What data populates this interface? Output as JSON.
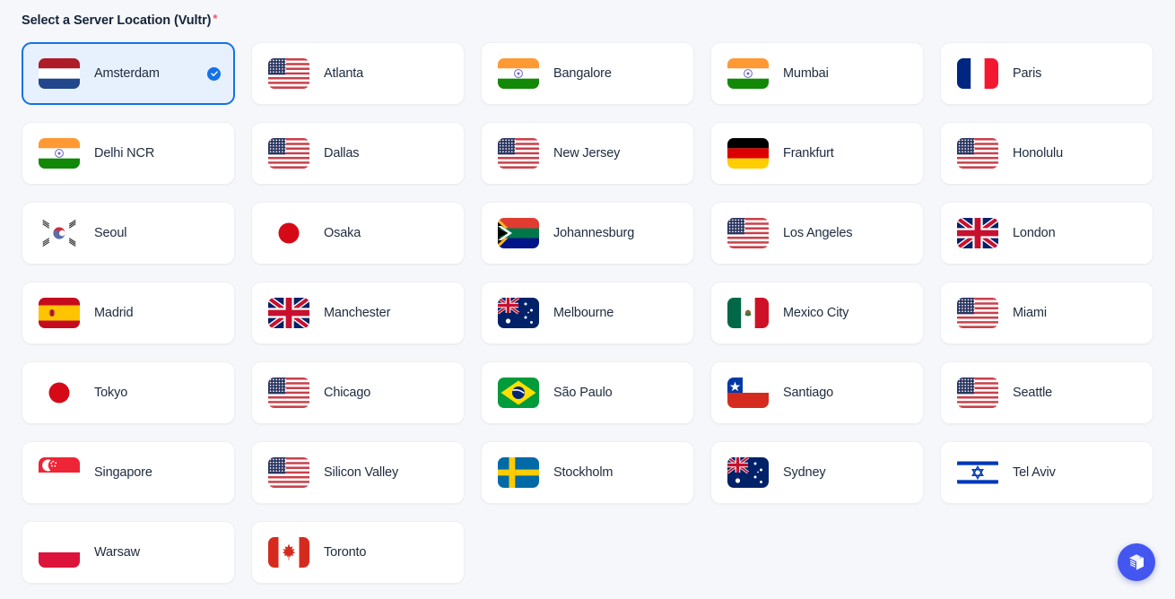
{
  "field": {
    "label": "Select a Server Location (Vultr)",
    "required_marker": "*"
  },
  "colors": {
    "page_background": "#f5f7fa",
    "card_background": "#ffffff",
    "card_border": "#eceff4",
    "selected_background": "#e7f0fd",
    "selected_border": "#1472e6",
    "accent_check": "#1472e6",
    "required_star": "#f2546b",
    "text": "#1d2b3f",
    "fab_background": "#4456f0"
  },
  "selected_location": "Amsterdam",
  "locations": [
    {
      "name": "Amsterdam",
      "flag": "nl-flag",
      "selected": true
    },
    {
      "name": "Atlanta",
      "flag": "us-flag",
      "selected": false
    },
    {
      "name": "Bangalore",
      "flag": "in-flag",
      "selected": false
    },
    {
      "name": "Mumbai",
      "flag": "in-flag",
      "selected": false
    },
    {
      "name": "Paris",
      "flag": "fr-flag",
      "selected": false
    },
    {
      "name": "Delhi NCR",
      "flag": "in-flag",
      "selected": false
    },
    {
      "name": "Dallas",
      "flag": "us-flag",
      "selected": false
    },
    {
      "name": "New Jersey",
      "flag": "us-flag",
      "selected": false
    },
    {
      "name": "Frankfurt",
      "flag": "de-flag",
      "selected": false
    },
    {
      "name": "Honolulu",
      "flag": "us-flag",
      "selected": false
    },
    {
      "name": "Seoul",
      "flag": "kr-flag",
      "selected": false
    },
    {
      "name": "Osaka",
      "flag": "jp-flag",
      "selected": false
    },
    {
      "name": "Johannesburg",
      "flag": "za-flag",
      "selected": false
    },
    {
      "name": "Los Angeles",
      "flag": "us-flag",
      "selected": false
    },
    {
      "name": "London",
      "flag": "gb-flag",
      "selected": false
    },
    {
      "name": "Madrid",
      "flag": "es-flag",
      "selected": false
    },
    {
      "name": "Manchester",
      "flag": "gb-flag",
      "selected": false
    },
    {
      "name": "Melbourne",
      "flag": "au-flag",
      "selected": false
    },
    {
      "name": "Mexico City",
      "flag": "mx-flag",
      "selected": false
    },
    {
      "name": "Miami",
      "flag": "us-flag",
      "selected": false
    },
    {
      "name": "Tokyo",
      "flag": "jp-flag",
      "selected": false
    },
    {
      "name": "Chicago",
      "flag": "us-flag",
      "selected": false
    },
    {
      "name": "São Paulo",
      "flag": "br-flag",
      "selected": false
    },
    {
      "name": "Santiago",
      "flag": "cl-flag",
      "selected": false
    },
    {
      "name": "Seattle",
      "flag": "us-flag",
      "selected": false
    },
    {
      "name": "Singapore",
      "flag": "sg-flag",
      "selected": false
    },
    {
      "name": "Silicon Valley",
      "flag": "us-flag",
      "selected": false
    },
    {
      "name": "Stockholm",
      "flag": "se-flag",
      "selected": false
    },
    {
      "name": "Sydney",
      "flag": "au-flag",
      "selected": false
    },
    {
      "name": "Tel Aviv",
      "flag": "il-flag",
      "selected": false
    },
    {
      "name": "Warsaw",
      "flag": "pl-flag",
      "selected": false
    },
    {
      "name": "Toronto",
      "flag": "ca-flag",
      "selected": false
    }
  ],
  "fab": {
    "icon": "cube-box-icon"
  }
}
